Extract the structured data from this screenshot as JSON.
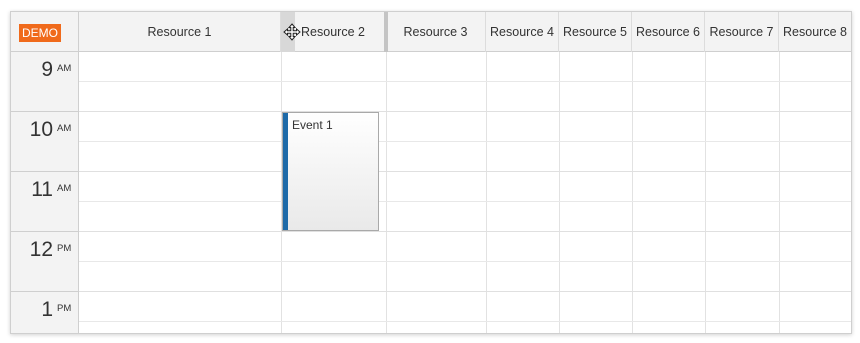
{
  "badge": {
    "label": "DEMO",
    "color": "#f06a1b"
  },
  "resources": [
    "Resource 1",
    "Resource 2",
    "Resource 3",
    "Resource 4",
    "Resource 5",
    "Resource 6",
    "Resource 7",
    "Resource 8"
  ],
  "hours": [
    {
      "num": "9",
      "ampm": "AM"
    },
    {
      "num": "10",
      "ampm": "AM"
    },
    {
      "num": "11",
      "ampm": "AM"
    },
    {
      "num": "12",
      "ampm": "PM"
    },
    {
      "num": "1",
      "ampm": "PM"
    }
  ],
  "event": {
    "text": "Event 1",
    "bar_color": "#1e6aa8"
  },
  "icons": {
    "move": "move-icon"
  }
}
